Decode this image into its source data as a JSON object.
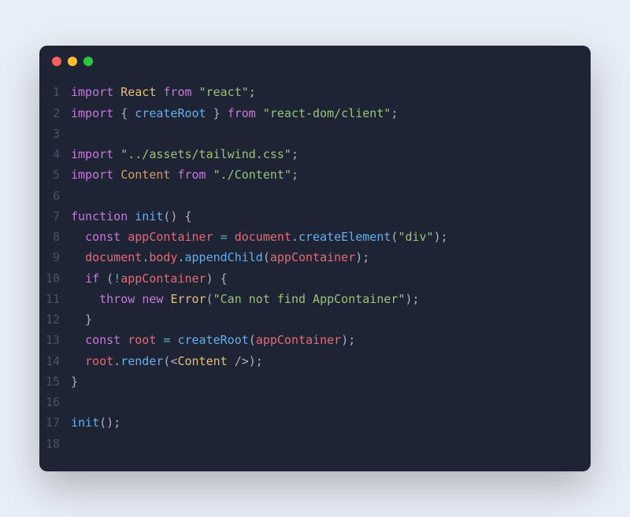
{
  "code": {
    "lines": [
      {
        "n": "1",
        "t": [
          {
            "c": "kw",
            "s": "import"
          },
          {
            "c": "pl",
            "s": " "
          },
          {
            "c": "def",
            "s": "React"
          },
          {
            "c": "pl",
            "s": " "
          },
          {
            "c": "kw",
            "s": "from"
          },
          {
            "c": "pl",
            "s": " "
          },
          {
            "c": "str",
            "s": "\"react\""
          },
          {
            "c": "pl",
            "s": ";"
          }
        ]
      },
      {
        "n": "2",
        "t": [
          {
            "c": "kw",
            "s": "import"
          },
          {
            "c": "pl",
            "s": " { "
          },
          {
            "c": "fn",
            "s": "createRoot"
          },
          {
            "c": "pl",
            "s": " } "
          },
          {
            "c": "kw",
            "s": "from"
          },
          {
            "c": "pl",
            "s": " "
          },
          {
            "c": "str",
            "s": "\"react-dom/client\""
          },
          {
            "c": "pl",
            "s": ";"
          }
        ]
      },
      {
        "n": "3",
        "t": []
      },
      {
        "n": "4",
        "t": [
          {
            "c": "kw",
            "s": "import"
          },
          {
            "c": "pl",
            "s": " "
          },
          {
            "c": "str",
            "s": "\"../assets/tailwind.css\""
          },
          {
            "c": "pl",
            "s": ";"
          }
        ]
      },
      {
        "n": "5",
        "t": [
          {
            "c": "kw",
            "s": "import"
          },
          {
            "c": "pl",
            "s": " "
          },
          {
            "c": "prop",
            "s": "Content"
          },
          {
            "c": "pl",
            "s": " "
          },
          {
            "c": "kw",
            "s": "from"
          },
          {
            "c": "pl",
            "s": " "
          },
          {
            "c": "str",
            "s": "\"./Content\""
          },
          {
            "c": "pl",
            "s": ";"
          }
        ]
      },
      {
        "n": "6",
        "t": []
      },
      {
        "n": "7",
        "t": [
          {
            "c": "kw",
            "s": "function"
          },
          {
            "c": "pl",
            "s": " "
          },
          {
            "c": "fn",
            "s": "init"
          },
          {
            "c": "pl",
            "s": "() {"
          }
        ]
      },
      {
        "n": "8",
        "t": [
          {
            "c": "pl",
            "s": "  "
          },
          {
            "c": "kw",
            "s": "const"
          },
          {
            "c": "pl",
            "s": " "
          },
          {
            "c": "var",
            "s": "appContainer"
          },
          {
            "c": "pl",
            "s": " "
          },
          {
            "c": "op",
            "s": "="
          },
          {
            "c": "pl",
            "s": " "
          },
          {
            "c": "var",
            "s": "document"
          },
          {
            "c": "pl",
            "s": "."
          },
          {
            "c": "fn",
            "s": "createElement"
          },
          {
            "c": "pl",
            "s": "("
          },
          {
            "c": "str",
            "s": "\"div\""
          },
          {
            "c": "pl",
            "s": ");"
          }
        ]
      },
      {
        "n": "9",
        "t": [
          {
            "c": "pl",
            "s": "  "
          },
          {
            "c": "var",
            "s": "document"
          },
          {
            "c": "pl",
            "s": "."
          },
          {
            "c": "var",
            "s": "body"
          },
          {
            "c": "pl",
            "s": "."
          },
          {
            "c": "fn",
            "s": "appendChild"
          },
          {
            "c": "pl",
            "s": "("
          },
          {
            "c": "var",
            "s": "appContainer"
          },
          {
            "c": "pl",
            "s": ");"
          }
        ]
      },
      {
        "n": "10",
        "t": [
          {
            "c": "pl",
            "s": "  "
          },
          {
            "c": "kw",
            "s": "if"
          },
          {
            "c": "pl",
            "s": " ("
          },
          {
            "c": "op",
            "s": "!"
          },
          {
            "c": "var",
            "s": "appContainer"
          },
          {
            "c": "pl",
            "s": ") {"
          }
        ]
      },
      {
        "n": "11",
        "t": [
          {
            "c": "pl",
            "s": "    "
          },
          {
            "c": "kw",
            "s": "throw"
          },
          {
            "c": "pl",
            "s": " "
          },
          {
            "c": "kw",
            "s": "new"
          },
          {
            "c": "pl",
            "s": " "
          },
          {
            "c": "def",
            "s": "Error"
          },
          {
            "c": "pl",
            "s": "("
          },
          {
            "c": "str",
            "s": "\"Can not find AppContainer\""
          },
          {
            "c": "pl",
            "s": ");"
          }
        ]
      },
      {
        "n": "12",
        "t": [
          {
            "c": "pl",
            "s": "  }"
          }
        ]
      },
      {
        "n": "13",
        "t": [
          {
            "c": "pl",
            "s": "  "
          },
          {
            "c": "kw",
            "s": "const"
          },
          {
            "c": "pl",
            "s": " "
          },
          {
            "c": "var",
            "s": "root"
          },
          {
            "c": "pl",
            "s": " "
          },
          {
            "c": "op",
            "s": "="
          },
          {
            "c": "pl",
            "s": " "
          },
          {
            "c": "fn",
            "s": "createRoot"
          },
          {
            "c": "pl",
            "s": "("
          },
          {
            "c": "var",
            "s": "appContainer"
          },
          {
            "c": "pl",
            "s": ");"
          }
        ]
      },
      {
        "n": "14",
        "t": [
          {
            "c": "pl",
            "s": "  "
          },
          {
            "c": "var",
            "s": "root"
          },
          {
            "c": "pl",
            "s": "."
          },
          {
            "c": "fn",
            "s": "render"
          },
          {
            "c": "pl",
            "s": "(<"
          },
          {
            "c": "tag",
            "s": "Content"
          },
          {
            "c": "pl",
            "s": " />);"
          }
        ]
      },
      {
        "n": "15",
        "t": [
          {
            "c": "pl",
            "s": "}"
          }
        ]
      },
      {
        "n": "16",
        "t": []
      },
      {
        "n": "17",
        "t": [
          {
            "c": "fn",
            "s": "init"
          },
          {
            "c": "pl",
            "s": "();"
          }
        ]
      },
      {
        "n": "18",
        "t": []
      }
    ]
  }
}
